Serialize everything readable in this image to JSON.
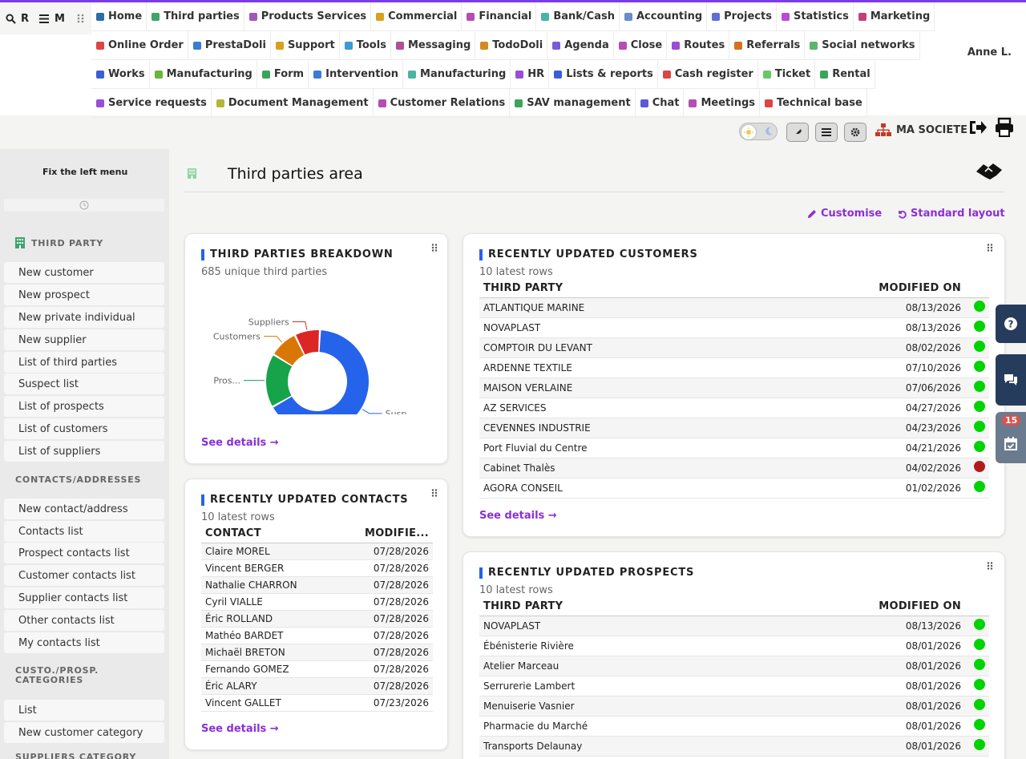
{
  "quick": {
    "search_label": "R",
    "menu_label": "M"
  },
  "menu": {
    "row1": [
      {
        "label": "Home",
        "icon": "home-icon",
        "color": "#2e6da4"
      },
      {
        "label": "Third parties",
        "icon": "building-icon",
        "color": "#3fa36b"
      },
      {
        "label": "Products Services",
        "icon": "cubes-icon",
        "color": "#a05ab2"
      },
      {
        "label": "Commercial",
        "icon": "euro-icon",
        "color": "#d6a21e"
      },
      {
        "label": "Financial",
        "icon": "coins-icon",
        "color": "#b54db5"
      },
      {
        "label": "Bank/Cash",
        "icon": "bank-icon",
        "color": "#4bb3a3"
      },
      {
        "label": "Accounting",
        "icon": "balance-icon",
        "color": "#6b8cc9"
      },
      {
        "label": "Projects",
        "icon": "sitemap-icon",
        "color": "#5b6fd6"
      },
      {
        "label": "Statistics",
        "icon": "chart-icon",
        "color": "#b54dd8"
      },
      {
        "label": "Marketing",
        "icon": "bullhorn-icon",
        "color": "#c2417a"
      }
    ],
    "row2": [
      {
        "label": "Online Order",
        "icon": "globe-icon",
        "color": "#d44"
      },
      {
        "label": "PrestaDoli",
        "icon": "sync-icon",
        "color": "#3a7bd5"
      },
      {
        "label": "Support",
        "icon": "briefcase-icon",
        "color": "#d6a21e"
      },
      {
        "label": "Tools",
        "icon": "tools-icon",
        "color": "#3a9bd5"
      },
      {
        "label": "Messaging",
        "icon": "mail-icon",
        "color": "#b54d9a"
      },
      {
        "label": "TodoDoli",
        "icon": "calendar-icon",
        "color": "#d68a1e"
      },
      {
        "label": "Agenda",
        "icon": "clock-icon",
        "color": "#7a5ad6"
      },
      {
        "label": "Close",
        "icon": "target-icon",
        "color": "#b54db5"
      },
      {
        "label": "Routes",
        "icon": "route-icon",
        "color": "#9a4dd6"
      },
      {
        "label": "Referrals",
        "icon": "bullhorn-icon",
        "color": "#d6701e"
      },
      {
        "label": "Social networks",
        "icon": "antenna-icon",
        "color": "#5bb56b"
      }
    ],
    "row3": [
      {
        "label": "Works",
        "icon": "road-icon",
        "color": "#3a5fd5"
      },
      {
        "label": "Manufacturing",
        "icon": "factory-icon",
        "color": "#6bb53a"
      },
      {
        "label": "Form",
        "icon": "form-icon",
        "color": "#3aa55a"
      },
      {
        "label": "Intervention",
        "icon": "wrench-icon",
        "color": "#3a7bd5"
      },
      {
        "label": "Manufacturing",
        "icon": "cube-icon",
        "color": "#4bb3a3"
      },
      {
        "label": "HR",
        "icon": "users-icon",
        "color": "#9a4dd6"
      },
      {
        "label": "Lists & reports",
        "icon": "table-icon",
        "color": "#3a5fd5"
      },
      {
        "label": "Cash register",
        "icon": "cash-icon",
        "color": "#d44"
      },
      {
        "label": "Ticket",
        "icon": "headset-icon",
        "color": "#6bc56b"
      },
      {
        "label": "Rental",
        "icon": "truck-icon",
        "color": "#3aa55a"
      }
    ],
    "row4": [
      {
        "label": "Service requests",
        "icon": "file-icon",
        "color": "#9a4dd6"
      },
      {
        "label": "Document Management",
        "icon": "folder-icon",
        "color": "#b5b53a"
      },
      {
        "label": "Customer Relations",
        "icon": "handshake-icon",
        "color": "#b54db5"
      },
      {
        "label": "SAV management",
        "icon": "handshake-icon",
        "color": "#3aa55a"
      },
      {
        "label": "Chat",
        "icon": "comments-icon",
        "color": "#5a5ad6"
      },
      {
        "label": "Meetings",
        "icon": "video-icon",
        "color": "#b54db5"
      },
      {
        "label": "Technical base",
        "icon": "book-icon",
        "color": "#d44"
      }
    ]
  },
  "user": {
    "name": "Anne L."
  },
  "company": {
    "name": "MA SOCIETE"
  },
  "sidebar": {
    "fix_label": "Fix the left menu",
    "sections": [
      {
        "title": "THIRD PARTY",
        "items": [
          "New customer",
          "New prospect",
          "New private individual",
          "New supplier",
          "List of third parties",
          "Suspect list",
          "List of prospects",
          "List of customers",
          "List of suppliers"
        ]
      },
      {
        "title": "CONTACTS/ADDRESSES",
        "items": [
          "New contact/address",
          "Contacts list",
          "Prospect contacts list",
          "Customer contacts list",
          "Supplier contacts list",
          "Other contacts list",
          "My contacts list"
        ]
      },
      {
        "title_line1": "CUSTO./PROSP.",
        "title_line2": "CATEGORIES",
        "items": [
          "List",
          "New customer category"
        ]
      },
      {
        "title": "SUPPLIERS CATEGORY"
      }
    ]
  },
  "page": {
    "title": "Third parties area",
    "customise": "Customise",
    "standard_layout": "Standard layout"
  },
  "breakdown": {
    "title": "THIRD PARTIES BREAKDOWN",
    "subtitle": "685 unique third parties",
    "see_details": "See details →",
    "chart_data": {
      "type": "pie",
      "labels": [
        "Susp...",
        "Pros...",
        "Customers",
        "Suppliers"
      ],
      "values": [
        66,
        17,
        9,
        8
      ],
      "colors": [
        "#2563eb",
        "#16a34a",
        "#d97706",
        "#dc2626"
      ]
    }
  },
  "contacts": {
    "title": "RECENTLY UPDATED CONTACTS",
    "subtitle": "10 latest rows",
    "col_contact": "CONTACT",
    "col_modified": "MODIFIE...",
    "rows": [
      [
        "Claire MOREL",
        "07/28/2026"
      ],
      [
        "Vincent BERGER",
        "07/28/2026"
      ],
      [
        "Nathalie CHARRON",
        "07/28/2026"
      ],
      [
        "Cyril VIALLE",
        "07/28/2026"
      ],
      [
        "Éric ROLLAND",
        "07/28/2026"
      ],
      [
        "Mathéo BARDET",
        "07/28/2026"
      ],
      [
        "Michaël BRETON",
        "07/28/2026"
      ],
      [
        "Fernando GOMEZ",
        "07/28/2026"
      ],
      [
        "Éric ALARY",
        "07/28/2026"
      ],
      [
        "Vincent GALLET",
        "07/23/2026"
      ]
    ],
    "see_details": "See details →"
  },
  "customers": {
    "title": "RECENTLY UPDATED CUSTOMERS",
    "subtitle": "10 latest rows",
    "col_party": "THIRD PARTY",
    "col_modified": "MODIFIED ON",
    "rows": [
      {
        "name": "ATLANTIQUE MARINE",
        "date": "08/13/2026",
        "status": "#00d400"
      },
      {
        "name": "NOVAPLAST",
        "date": "08/13/2026",
        "status": "#00d400"
      },
      {
        "name": "COMPTOIR DU LEVANT",
        "date": "08/02/2026",
        "status": "#00d400"
      },
      {
        "name": "ARDENNE TEXTILE",
        "date": "07/10/2026",
        "status": "#00d400"
      },
      {
        "name": "MAISON VERLAINE",
        "date": "07/06/2026",
        "status": "#00d400"
      },
      {
        "name": "AZ SERVICES",
        "date": "04/27/2026",
        "status": "#00d400"
      },
      {
        "name": "CEVENNES INDUSTRIE",
        "date": "04/23/2026",
        "status": "#00d400"
      },
      {
        "name": "Port Fluvial du Centre",
        "date": "04/21/2026",
        "status": "#00d400"
      },
      {
        "name": "Cabinet Thalès",
        "date": "04/02/2026",
        "status": "#b01c1c"
      },
      {
        "name": "AGORA CONSEIL",
        "date": "01/02/2026",
        "status": "#00d400"
      }
    ],
    "see_details": "See details →"
  },
  "prospects": {
    "title": "RECENTLY UPDATED PROSPECTS",
    "subtitle": "10 latest rows",
    "col_party": "THIRD PARTY",
    "col_modified": "MODIFIED ON",
    "rows": [
      {
        "name": "NOVAPLAST",
        "date": "08/13/2026",
        "status": "#00d400"
      },
      {
        "name": "Ébénisterie Rivière",
        "date": "08/01/2026",
        "status": "#00d400"
      },
      {
        "name": "Atelier Marceau",
        "date": "08/01/2026",
        "status": "#00d400"
      },
      {
        "name": "Serrurerie Lambert",
        "date": "08/01/2026",
        "status": "#00d400"
      },
      {
        "name": "Menuiserie Vasnier",
        "date": "08/01/2026",
        "status": "#00d400"
      },
      {
        "name": "Pharmacie du Marché",
        "date": "08/01/2026",
        "status": "#00d400"
      },
      {
        "name": "Transports Delaunay",
        "date": "08/01/2026",
        "status": "#00d400"
      }
    ]
  },
  "right_panel": {
    "badge": "15"
  }
}
